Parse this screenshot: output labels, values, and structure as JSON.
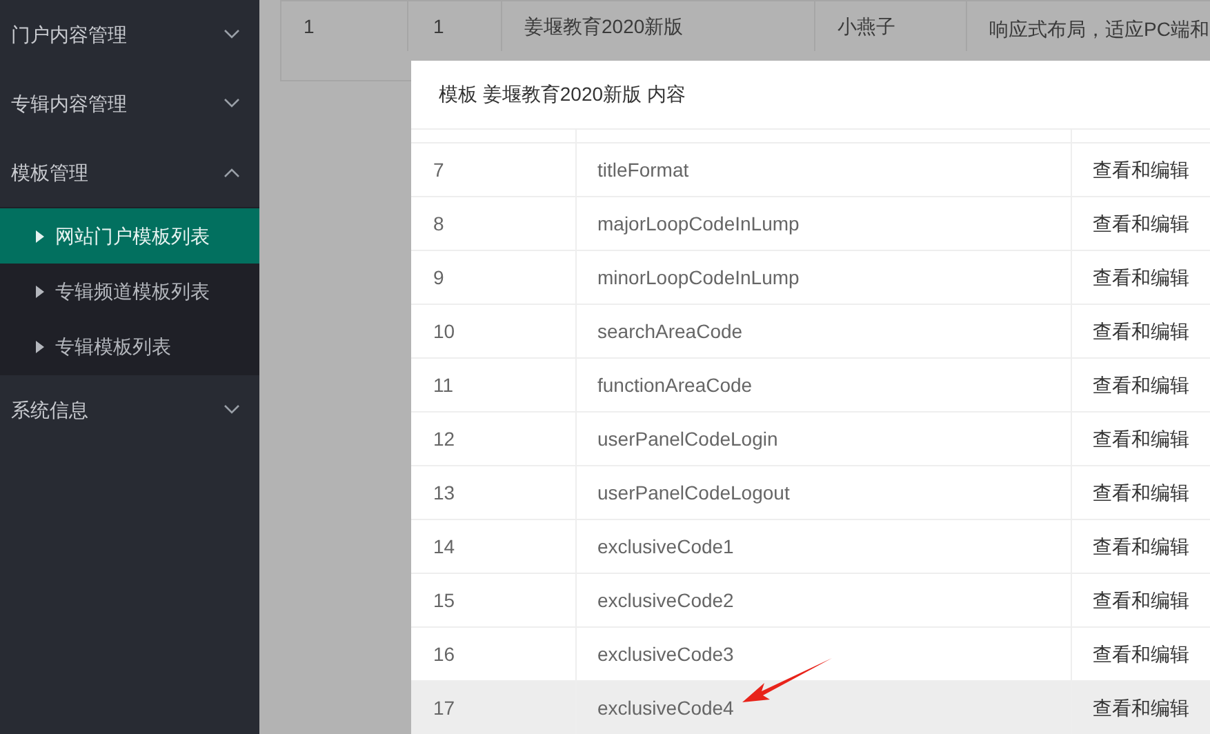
{
  "sidebar": {
    "groups": [
      {
        "label": "门户内容管理",
        "expanded": false
      },
      {
        "label": "专辑内容管理",
        "expanded": false
      },
      {
        "label": "模板管理",
        "expanded": true,
        "children": [
          {
            "label": "网站门户模板列表",
            "selected": true
          },
          {
            "label": "专辑频道模板列表",
            "selected": false
          },
          {
            "label": "专辑模板列表",
            "selected": false
          }
        ]
      },
      {
        "label": "系统信息",
        "expanded": false
      }
    ]
  },
  "background_table": {
    "row": {
      "column_1": "1",
      "column_2": "1",
      "column_3": "姜堰教育2020新版",
      "column_4": "小燕子",
      "column_5": "响应式布局，适应PC端和"
    }
  },
  "modal": {
    "title": "模板 姜堰教育2020新版 内容",
    "rows": [
      {
        "index": "7",
        "name": "titleFormat",
        "action": "查看和编辑",
        "highlighted": false
      },
      {
        "index": "8",
        "name": "majorLoopCodeInLump",
        "action": "查看和编辑",
        "highlighted": false
      },
      {
        "index": "9",
        "name": "minorLoopCodeInLump",
        "action": "查看和编辑",
        "highlighted": false
      },
      {
        "index": "10",
        "name": "searchAreaCode",
        "action": "查看和编辑",
        "highlighted": false
      },
      {
        "index": "11",
        "name": "functionAreaCode",
        "action": "查看和编辑",
        "highlighted": false
      },
      {
        "index": "12",
        "name": "userPanelCodeLogin",
        "action": "查看和编辑",
        "highlighted": false
      },
      {
        "index": "13",
        "name": "userPanelCodeLogout",
        "action": "查看和编辑",
        "highlighted": false
      },
      {
        "index": "14",
        "name": "exclusiveCode1",
        "action": "查看和编辑",
        "highlighted": false
      },
      {
        "index": "15",
        "name": "exclusiveCode2",
        "action": "查看和编辑",
        "highlighted": false
      },
      {
        "index": "16",
        "name": "exclusiveCode3",
        "action": "查看和编辑",
        "highlighted": false
      },
      {
        "index": "17",
        "name": "exclusiveCode4",
        "action": "查看和编辑",
        "highlighted": true
      }
    ]
  }
}
